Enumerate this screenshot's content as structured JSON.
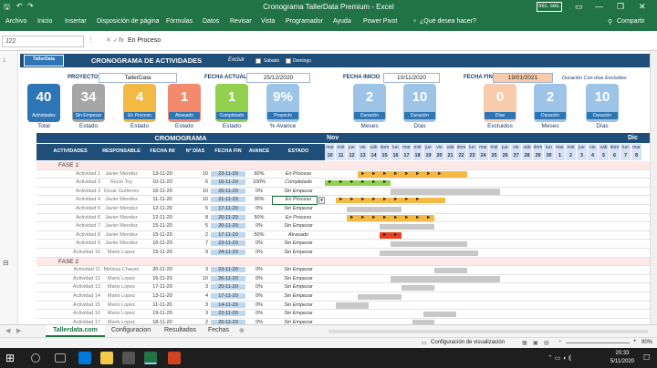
{
  "window": {
    "title": "Cronograma TallerData Premium  -  Excel",
    "signin": "Inic. ses."
  },
  "ribbon": {
    "tabs": [
      "Archivo",
      "Inicio",
      "Insertar",
      "Disposición de página",
      "Fórmulas",
      "Datos",
      "Revisar",
      "Vista",
      "Programador",
      "Ayuda",
      "Power Pivot",
      "¿Qué desea hacer?"
    ],
    "share": "Compartir"
  },
  "formula": {
    "cell": "J22",
    "fx": "fx",
    "value": "En Proceso"
  },
  "dashboard": {
    "logo": "TallerData",
    "title": "CRONOGRAMA DE ACTIVIDADES",
    "excluir": "Excluir",
    "opt1": "Sábado",
    "opt2": "Domingo",
    "proyecto_lbl": "PROYECTO",
    "proyecto_val": "TallerData",
    "fecha_actual_lbl": "FECHA ACTUAL",
    "fecha_actual_val": "25/12/2020",
    "fecha_inicio_lbl": "FECHA INICIO",
    "fecha_inicio_val": "10/11/2020",
    "fecha_fin_lbl": "FECHA FIN",
    "fecha_fin_val": "19/01/2021",
    "duracion_note": "Duración Con días Excluidos",
    "kpis": [
      {
        "num": "40",
        "cap": "Actividades",
        "label": "Total",
        "color": "#2e75b6"
      },
      {
        "num": "34",
        "cap": "Sin Empezar",
        "label": "Estado",
        "color": "#a6a6a6"
      },
      {
        "num": "4",
        "cap": "En Proceso",
        "label": "Estado",
        "color": "#f4b942"
      },
      {
        "num": "1",
        "cap": "Atrasado",
        "label": "Estado",
        "color": "#f28b6d"
      },
      {
        "num": "1",
        "cap": "Completado",
        "label": "Estado",
        "color": "#92d050"
      },
      {
        "num": "9%",
        "cap": "Proyecto",
        "label": "% Avance",
        "color": "#9dc3e6"
      }
    ],
    "dur": [
      {
        "num": "2",
        "cap": "Duración",
        "label": "Meses",
        "color": "#9dc3e6"
      },
      {
        "num": "10",
        "cap": "Duración",
        "label": "Días",
        "color": "#9dc3e6"
      },
      {
        "num": "0",
        "cap": "Días",
        "label": "Excluidos",
        "color": "#f8cbad"
      },
      {
        "num": "2",
        "cap": "Duración",
        "label": "Meses",
        "color": "#9dc3e6"
      },
      {
        "num": "10",
        "cap": "Duración",
        "label": "Días",
        "color": "#9dc3e6"
      }
    ]
  },
  "gantt": {
    "title": "CROMOGRAMA",
    "month1": "Nov",
    "month2": "Dic",
    "headers": [
      "ACTIVIDADES",
      "RESPONSABLE",
      "FECHA INI",
      "Nº DÍAS",
      "FECHA FIN",
      "AVANCE",
      "ESTADO"
    ],
    "weekdays": [
      "mar",
      "mié",
      "jue",
      "vie",
      "sáb",
      "dom",
      "lun",
      "mar",
      "mié",
      "jue",
      "vie",
      "sáb",
      "dom",
      "lun",
      "mar",
      "mié",
      "jue",
      "vie",
      "sáb",
      "dom",
      "lun",
      "mar",
      "mié",
      "jue",
      "vie",
      "sáb",
      "dom",
      "lun",
      "mar"
    ],
    "days": [
      "10",
      "11",
      "12",
      "13",
      "14",
      "15",
      "16",
      "17",
      "18",
      "19",
      "20",
      "21",
      "22",
      "23",
      "24",
      "25",
      "26",
      "27",
      "28",
      "29",
      "30",
      "1",
      "2",
      "3",
      "4",
      "5",
      "6",
      "7",
      "8"
    ],
    "rows": [
      {
        "type": "phase",
        "name": "FASE 1"
      },
      {
        "name": "Actividad 1",
        "resp": "Javier Mendez",
        "ini": "13-11-20",
        "dias": "10",
        "fin": "23-11-20",
        "av": "60%",
        "estado": "En Proceso",
        "bar": [
          3,
          13
        ],
        "color": "#f4b942",
        "done": 8
      },
      {
        "name": "Actividad 2",
        "resp": "Rocio Toy",
        "ini": "10-11-20",
        "dias": "6",
        "fin": "16-11-20",
        "av": "100%",
        "estado": "Completado",
        "bar": [
          0,
          6
        ],
        "color": "#92d050",
        "done": 6
      },
      {
        "name": "Actividad 3",
        "resp": "Oscar Gutierrez",
        "ini": "16-11-20",
        "dias": "10",
        "fin": "26-11-20",
        "av": "0%",
        "estado": "Sin Empezar",
        "bar": [
          6,
          16
        ],
        "color": "#c8c8c8",
        "done": 0
      },
      {
        "name": "Actividad 4",
        "resp": "Javier Mendez",
        "ini": "11-11-20",
        "dias": "10",
        "fin": "21-11-20",
        "av": "30%",
        "estado": "En Proceso",
        "bar": [
          1,
          11
        ],
        "color": "#f4b942",
        "done": 0
      },
      {
        "name": "Actividad 5",
        "resp": "Javier Mendez",
        "ini": "12-11-20",
        "dias": "5",
        "fin": "17-11-20",
        "av": "0%",
        "estado": "Sin Empezar",
        "bar": [
          2,
          7
        ],
        "color": "#c8c8c8",
        "done": 0
      },
      {
        "name": "Actividad 6",
        "resp": "Javier Mendez",
        "ini": "12-11-20",
        "dias": "8",
        "fin": "20-11-20",
        "av": "50%",
        "estado": "En Proceso",
        "bar": [
          2,
          10
        ],
        "color": "#f4b942",
        "done": 0
      },
      {
        "name": "Actividad 7",
        "resp": "Javier Mendez",
        "ini": "15-11-20",
        "dias": "5",
        "fin": "20-11-20",
        "av": "0%",
        "estado": "Sin Empezar",
        "bar": [
          5,
          10
        ],
        "color": "#c8c8c8",
        "done": 0
      },
      {
        "name": "Actividad 8",
        "resp": "Javier Mendez",
        "ini": "15-11-20",
        "dias": "2",
        "fin": "17-11-20",
        "av": "50%",
        "estado": "Atrasado",
        "bar": [
          5,
          7
        ],
        "color": "#e8421c",
        "done": 0
      },
      {
        "name": "Actividad 9",
        "resp": "Javier Mendez",
        "ini": "16-11-20",
        "dias": "7",
        "fin": "23-11-20",
        "av": "0%",
        "estado": "Sin Empezar",
        "bar": [
          6,
          13
        ],
        "color": "#c8c8c8",
        "done": 0
      },
      {
        "name": "Actividad 10",
        "resp": "Mario Lopez",
        "ini": "15-11-20",
        "dias": "9",
        "fin": "24-11-20",
        "av": "0%",
        "estado": "Sin Empezar",
        "bar": [
          5,
          14
        ],
        "color": "#c8c8c8",
        "done": 0
      },
      {
        "type": "phase",
        "name": "FASE 2"
      },
      {
        "name": "Actividad 11",
        "resp": "Melissa Chavez",
        "ini": "20-11-20",
        "dias": "3",
        "fin": "23-11-20",
        "av": "0%",
        "estado": "Sin Empezar",
        "bar": [
          10,
          13
        ],
        "color": "#c8c8c8",
        "done": 0
      },
      {
        "name": "Actividad 12",
        "resp": "Mario Lopez",
        "ini": "16-11-20",
        "dias": "10",
        "fin": "26-11-20",
        "av": "0%",
        "estado": "Sin Empezar",
        "bar": [
          6,
          16
        ],
        "color": "#c8c8c8",
        "done": 0
      },
      {
        "name": "Actividad 13",
        "resp": "Mario Lopez",
        "ini": "17-11-20",
        "dias": "3",
        "fin": "20-11-20",
        "av": "0%",
        "estado": "Sin Empezar",
        "bar": [
          7,
          10
        ],
        "color": "#c8c8c8",
        "done": 0
      },
      {
        "name": "Actividad 14",
        "resp": "Mario Lopez",
        "ini": "13-11-20",
        "dias": "4",
        "fin": "17-11-20",
        "av": "0%",
        "estado": "Sin Empezar",
        "bar": [
          3,
          7
        ],
        "color": "#c8c8c8",
        "done": 0
      },
      {
        "name": "Actividad 15",
        "resp": "Mario Lopez",
        "ini": "11-11-20",
        "dias": "3",
        "fin": "14-11-20",
        "av": "0%",
        "estado": "Sin Empezar",
        "bar": [
          1,
          4
        ],
        "color": "#c8c8c8",
        "done": 0
      },
      {
        "name": "Actividad 16",
        "resp": "Mario Lopez",
        "ini": "19-11-20",
        "dias": "3",
        "fin": "22-11-20",
        "av": "0%",
        "estado": "Sin Empezar",
        "bar": [
          9,
          12
        ],
        "color": "#c8c8c8",
        "done": 0
      },
      {
        "name": "Actividad 17",
        "resp": "Mario Lopez",
        "ini": "18-11-20",
        "dias": "2",
        "fin": "20-11-20",
        "av": "0%",
        "estado": "Sin Empezar",
        "bar": [
          8,
          10
        ],
        "color": "#c8c8c8",
        "done": 0
      }
    ]
  },
  "tabs": [
    "Tallerdata.com",
    "Configuracion",
    "Resultados",
    "Fechas"
  ],
  "status": {
    "view": "Configuración de visualización",
    "zoom": "90%"
  },
  "clock": {
    "time": "20:33",
    "date": "5/11/2020"
  }
}
